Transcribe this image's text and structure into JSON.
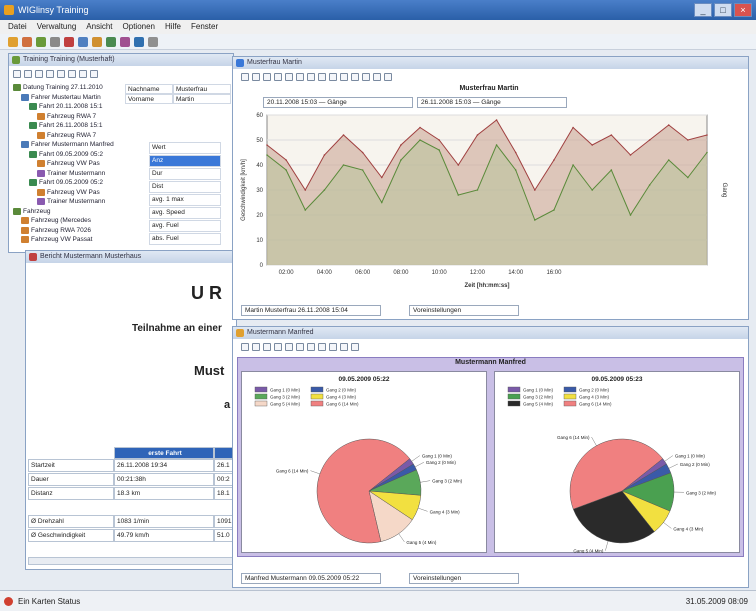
{
  "app": {
    "title": "WIGlinsy Training"
  },
  "menu": [
    "Datei",
    "Verwaltung",
    "Ansicht",
    "Optionen",
    "Hilfe",
    "Fenster"
  ],
  "tree_window": {
    "title": "Training Training (Musterhaft)",
    "items": [
      "Datung Training 27.11.2010",
      "Fahrer Mustertau Martin",
      "Fahrt 20.11.2008 15:1",
      "Fahrzeug RWA 7",
      "Fahrt 26.11.2008 15:1",
      "Fahrzeug RWA 7",
      "Fahrer Mustermann Manfred",
      "Fahrt 09.05.2009 05:2",
      "Fahrzeug VW Pas",
      "Trainer Mustermann",
      "Fahrt 09.05.2009 05:2",
      "Fahrzeug VW Pas",
      "Trainer Mustermann",
      "Fahrzeug",
      "Fahrzeug (Mercedes",
      "Fahrzeug RWA 7026",
      "Fahrzeug VW Passat"
    ],
    "props": [
      {
        "label": "Nachname",
        "value": "Musterfrau"
      },
      {
        "label": "Vorname",
        "value": "Martin"
      }
    ],
    "grid": [
      {
        "label": "Wert",
        "selected": false
      },
      {
        "label": "Anz",
        "selected": true
      },
      {
        "label": "Dur",
        "selected": false
      },
      {
        "label": "Dist",
        "selected": false
      },
      {
        "label": "avg. 1 max",
        "selected": false
      },
      {
        "label": "avg. Speed",
        "selected": false
      },
      {
        "label": "avg. Fuel",
        "selected": false
      },
      {
        "label": "abs. Fuel",
        "selected": false
      }
    ]
  },
  "report_window": {
    "title": "Bericht Mustermann Musterhaus",
    "heading1": "U R",
    "heading2": "Teilnahme an einer",
    "heading3": "Must",
    "heading4": "a",
    "table_header": "erste Fahrt",
    "rows": [
      {
        "label": "Startzeit",
        "value": "26.11.2008 19:34",
        "value2": "26.1"
      },
      {
        "label": "Dauer",
        "value": "00:21:38h",
        "value2": "00:2"
      },
      {
        "label": "Distanz",
        "value": "18.3 km",
        "value2": "18.1"
      },
      {
        "label": "Ø Drehzahl",
        "value": "1083 1/min",
        "value2": "1091"
      },
      {
        "label": "Ø Geschwindigkeit",
        "value": "49.79 km/h",
        "value2": "51.0"
      }
    ]
  },
  "line_window": {
    "title": "Musterfrau Martin",
    "chart_title": "Musterfrau Martin",
    "ylabel": "Geschwindigkeit [km/h]",
    "y2label": "Gang",
    "xlabel": "Zeit [hh:mm:ss]",
    "legend": [
      "20.11.2008 15:03 — Gänge",
      "26.11.2008 15:03 — Gänge"
    ],
    "footer_combo": "Martin Musterfrau 26.11.2008 15:04",
    "footer_combo2": "Voreinstellungen"
  },
  "pie_window": {
    "title": "Mustermann Manfred",
    "chart_title": "Mustermann Manfred",
    "footer_combo": "Manfred Mustermann 09.05.2009 05:22",
    "footer_combo2": "Voreinstellungen"
  },
  "status": {
    "left": "Ein Karten Status",
    "right": "31.05.2009 08:09"
  },
  "colors": {
    "accent": "#2f64b8",
    "title": "#2a5fa8"
  },
  "chart_data": [
    {
      "type": "area",
      "title": "Musterfrau Martin",
      "xlabel": "Zeit [hh:mm:ss]",
      "ylabel": "Geschwindigkeit [km/h]",
      "x": [
        "01:00",
        "02:00",
        "03:00",
        "04:00",
        "05:00",
        "06:00",
        "07:00",
        "08:00",
        "09:00",
        "10:00",
        "11:00",
        "12:00",
        "13:00",
        "14:00",
        "15:00",
        "16:00",
        "17:00",
        "18:00",
        "19:00",
        "20:00",
        "21:00",
        "22:00",
        "23:00",
        "24:00"
      ],
      "xticks": [
        "02:00",
        "04:00",
        "06:00",
        "08:00",
        "10:00",
        "12:00",
        "14:00",
        "16:00"
      ],
      "ylim": [
        0,
        60
      ],
      "yticks": [
        0,
        10,
        20,
        30,
        40,
        50,
        60
      ],
      "series": [
        {
          "name": "20.11.2008 15:03",
          "values": [
            48,
            42,
            30,
            44,
            52,
            45,
            35,
            48,
            55,
            50,
            40,
            52,
            58,
            45,
            30,
            42,
            55,
            48,
            52,
            44,
            50,
            56,
            50,
            52
          ]
        },
        {
          "name": "26.11.2008 15:03",
          "values": [
            44,
            38,
            22,
            30,
            40,
            38,
            25,
            42,
            50,
            46,
            28,
            30,
            48,
            38,
            18,
            22,
            40,
            30,
            38,
            20,
            32,
            42,
            35,
            45
          ]
        }
      ]
    },
    {
      "type": "pie",
      "title": "09.05.2009 05:22",
      "labels": [
        "Gang 1 (0 Min)",
        "Gang 2 (0 Min)",
        "Gang 3 (2 Min)",
        "Gang 4 (3 Min)",
        "Gang 5 (4 Min)",
        "Gang 6 (14 Min)"
      ],
      "values": [
        2,
        2,
        8,
        8,
        12,
        68
      ]
    },
    {
      "type": "pie",
      "title": "09.05.2009 05:23",
      "labels": [
        "Gang 1 (0 Min)",
        "Gang 2 (0 Min)",
        "Gang 3 (2 Min)",
        "Gang 4 (3 Min)",
        "Gang 5 (4 Min)",
        "Gang 6 (14 Min)"
      ],
      "values": [
        2,
        3,
        12,
        8,
        30,
        45
      ]
    }
  ]
}
